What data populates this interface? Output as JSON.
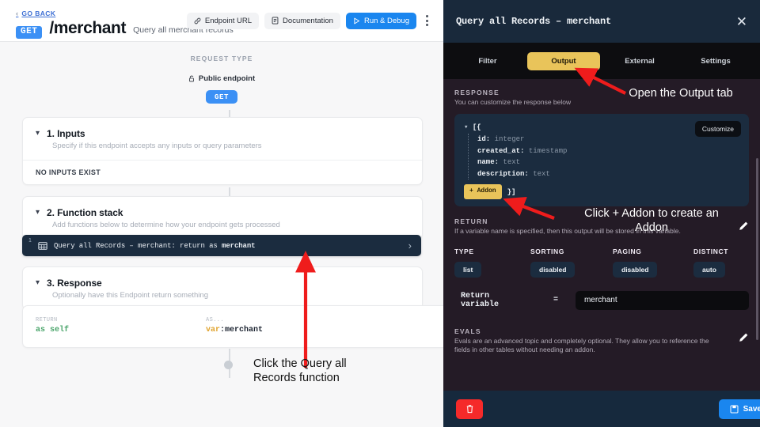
{
  "left": {
    "go_back": "GO BACK",
    "verb": "GET",
    "path": "/merchant",
    "subtitle": "Query all merchant records",
    "actions": {
      "endpoint_url": "Endpoint URL",
      "documentation": "Documentation",
      "run_debug": "Run & Debug"
    },
    "request_type_label": "REQUEST TYPE",
    "public_endpoint": "Public endpoint",
    "method_pill": "GET",
    "sections": [
      {
        "title": "1. Inputs",
        "subtitle": "Specify if this endpoint accepts any inputs or query parameters",
        "row": "NO INPUTS EXIST"
      },
      {
        "title": "2. Function stack",
        "subtitle": "Add functions below to determine how your endpoint gets processed"
      },
      {
        "title": "3. Response",
        "subtitle": "Optionally have this Endpoint return something"
      }
    ],
    "function_row": {
      "index": "1",
      "text_prefix": "Query all Records – merchant: return as ",
      "text_bold": "merchant"
    },
    "return_card": {
      "left_label": "RETURN",
      "left_value": "as self",
      "right_label": "AS...",
      "right_prefix": "var",
      "right_value": ":merchant"
    }
  },
  "modal": {
    "title": "Query all Records – merchant",
    "tabs": [
      {
        "label": "Filter",
        "active": false
      },
      {
        "label": "Output",
        "active": true
      },
      {
        "label": "External",
        "active": false
      },
      {
        "label": "Settings",
        "active": false
      }
    ],
    "response": {
      "label": "RESPONSE",
      "sublabel": "You can customize the response below",
      "customize_button": "Customize",
      "open_bracket": "[{",
      "fields": [
        {
          "key": "id:",
          "type": "integer"
        },
        {
          "key": "created_at:",
          "type": "timestamp"
        },
        {
          "key": "name:",
          "type": "text"
        },
        {
          "key": "description:",
          "type": "text"
        }
      ],
      "addon_button": "+ Addon",
      "close_bracket": "}]"
    },
    "return": {
      "label": "RETURN",
      "sublabel": "If a variable name is specified, then this output will be stored in this variable."
    },
    "chips": [
      {
        "label": "TYPE",
        "value": "list"
      },
      {
        "label": "SORTING",
        "value": "disabled"
      },
      {
        "label": "PAGING",
        "value": "disabled"
      },
      {
        "label": "DISTINCT",
        "value": "auto"
      }
    ],
    "variable_row": {
      "label": "Return variable",
      "equals": "=",
      "value": "merchant"
    },
    "evals": {
      "label": "EVALS",
      "sublabel": "Evals are an advanced topic and completely optional. They allow you to reference the fields in other tables without needing an addon."
    },
    "footer": {
      "save_label": "Save"
    }
  },
  "annotations": [
    {
      "text": "Open the Output tab",
      "color": "#ffffff"
    },
    {
      "text": "Click + Addon to create an",
      "text2": "Addon",
      "color": "#ffffff"
    },
    {
      "text": "Click the Query all",
      "text2": "Records function",
      "color": "#121212"
    }
  ],
  "colors": {
    "accent_blue": "#1a86ef",
    "accent_yellow": "#e9c45a",
    "arrow_red": "#ef1c1c",
    "dark_navy": "#1b2c3f",
    "modal_body": "#241b26"
  }
}
